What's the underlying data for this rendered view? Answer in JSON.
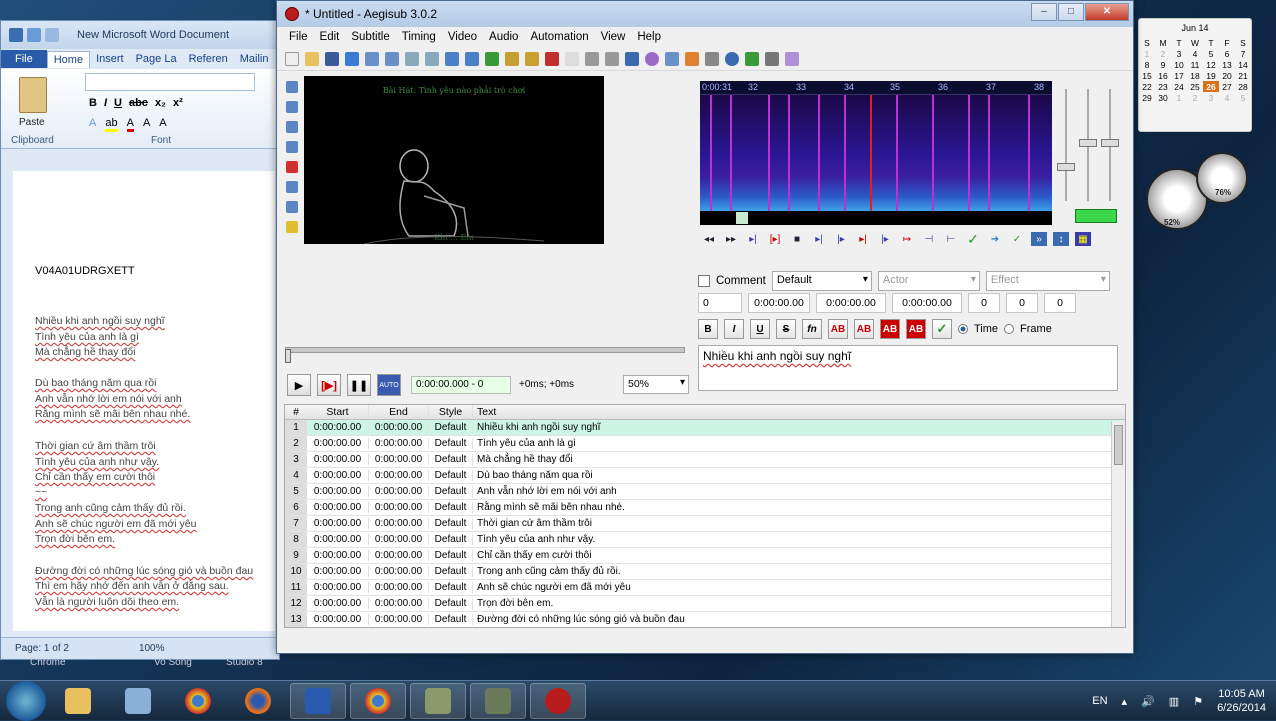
{
  "word": {
    "title": "New Microsoft Word Document",
    "tabs": [
      "File",
      "Home",
      "Insert",
      "Page La",
      "Referen",
      "Mailin"
    ],
    "groups": {
      "clipboard": "Clipboard",
      "font": "Font",
      "paste": "Paste"
    },
    "code": "V04A01UDRGXETT",
    "lines": [
      "Nhiều khi anh ngồi suy nghĩ",
      "Tình yêu của anh là gì",
      "Mà chẳng hề thay đổi",
      "Dù bao tháng năm qua rồi",
      "Anh vẫn nhớ lời em nói với anh",
      "Rằng mình sẽ mãi bên nhau nhé.",
      "Thời gian cứ âm thầm trôi",
      "Tình yêu của anh như vậy.",
      "Chỉ cần thấy em cười thôi",
      "~~",
      "Trong anh cũng cảm thấy đủ rồi.",
      "Anh sẽ chúc người em đã mới yêu",
      "Trọn đời bên em.",
      "Đường đời có những lúc sóng gió và buồn đau",
      "Thì em hãy nhớ đến anh vẫn ở đằng sau.",
      "Vẫn là người luôn dõi theo em."
    ],
    "status": {
      "page": "Page: 1 of 2",
      "zoom": "100%"
    }
  },
  "aegisub": {
    "title": "* Untitled - Aegisub 3.0.2",
    "menu": [
      "File",
      "Edit",
      "Subtitle",
      "Timing",
      "Video",
      "Audio",
      "Automation",
      "View",
      "Help"
    ],
    "video_sub_top": "Bài Hát: Tình yêu nào phải trò chơi",
    "video_sub_bottom": "Khi ... Em",
    "video_time": "0:00:00.000 - 0",
    "video_offset": "+0ms; +0ms",
    "zoom": "50%",
    "auto_label": "AUTO",
    "ruler": [
      "0:00:31",
      "32",
      "33",
      "34",
      "35",
      "36",
      "37",
      "38"
    ],
    "edit": {
      "comment_label": "Comment",
      "style": "Default",
      "actor_placeholder": "Actor",
      "effect_placeholder": "Effect",
      "layer": "0",
      "start": "0:00:00.00",
      "end": "0:00:00.00",
      "duration": "0:00:00.00",
      "margins": [
        "0",
        "0",
        "0"
      ],
      "format_buttons": [
        "B",
        "I",
        "U",
        "S",
        "fn",
        "AB",
        "AB",
        "AB",
        "AB"
      ],
      "time_label": "Time",
      "frame_label": "Frame",
      "text": "Nhiều khi anh ngồi suy nghĩ"
    },
    "grid_headers": [
      "#",
      "Start",
      "End",
      "Style",
      "Text"
    ],
    "rows": [
      {
        "n": "1",
        "s": "0:00:00.00",
        "e": "0:00:00.00",
        "st": "Default",
        "t": "Nhiều khi anh ngồi suy nghĩ"
      },
      {
        "n": "2",
        "s": "0:00:00.00",
        "e": "0:00:00.00",
        "st": "Default",
        "t": "Tình yêu của anh là gì"
      },
      {
        "n": "3",
        "s": "0:00:00.00",
        "e": "0:00:00.00",
        "st": "Default",
        "t": "Mà chẳng hề thay đổi"
      },
      {
        "n": "4",
        "s": "0:00:00.00",
        "e": "0:00:00.00",
        "st": "Default",
        "t": "Dù bao tháng năm qua rồi"
      },
      {
        "n": "5",
        "s": "0:00:00.00",
        "e": "0:00:00.00",
        "st": "Default",
        "t": "Anh vẫn nhớ lời em nói với anh"
      },
      {
        "n": "6",
        "s": "0:00:00.00",
        "e": "0:00:00.00",
        "st": "Default",
        "t": "Rằng mình sẽ mãi bên nhau nhé."
      },
      {
        "n": "7",
        "s": "0:00:00.00",
        "e": "0:00:00.00",
        "st": "Default",
        "t": "Thời gian cứ âm thầm trôi"
      },
      {
        "n": "8",
        "s": "0:00:00.00",
        "e": "0:00:00.00",
        "st": "Default",
        "t": "Tình yêu của anh như vậy."
      },
      {
        "n": "9",
        "s": "0:00:00.00",
        "e": "0:00:00.00",
        "st": "Default",
        "t": "Chỉ cần thấy em cười thôi"
      },
      {
        "n": "10",
        "s": "0:00:00.00",
        "e": "0:00:00.00",
        "st": "Default",
        "t": "Trong anh cũng cảm thấy đủ rồi."
      },
      {
        "n": "11",
        "s": "0:00:00.00",
        "e": "0:00:00.00",
        "st": "Default",
        "t": "Anh sẽ chúc người em đã mới yêu"
      },
      {
        "n": "12",
        "s": "0:00:00.00",
        "e": "0:00:00.00",
        "st": "Default",
        "t": "Trọn đời bên em."
      },
      {
        "n": "13",
        "s": "0:00:00.00",
        "e": "0:00:00.00",
        "st": "Default",
        "t": "Đường đời có những lúc sóng gió và buồn đau"
      }
    ]
  },
  "taskbar": {
    "lang": "EN",
    "time": "10:05 AM",
    "date": "6/26/2014",
    "labels": [
      "Chrome",
      "Vo Song",
      "Studio 8"
    ]
  },
  "calendar": {
    "month": "Jun 14",
    "today": "26"
  },
  "gadget": {
    "cpu": "52%",
    "mem": "76%"
  }
}
